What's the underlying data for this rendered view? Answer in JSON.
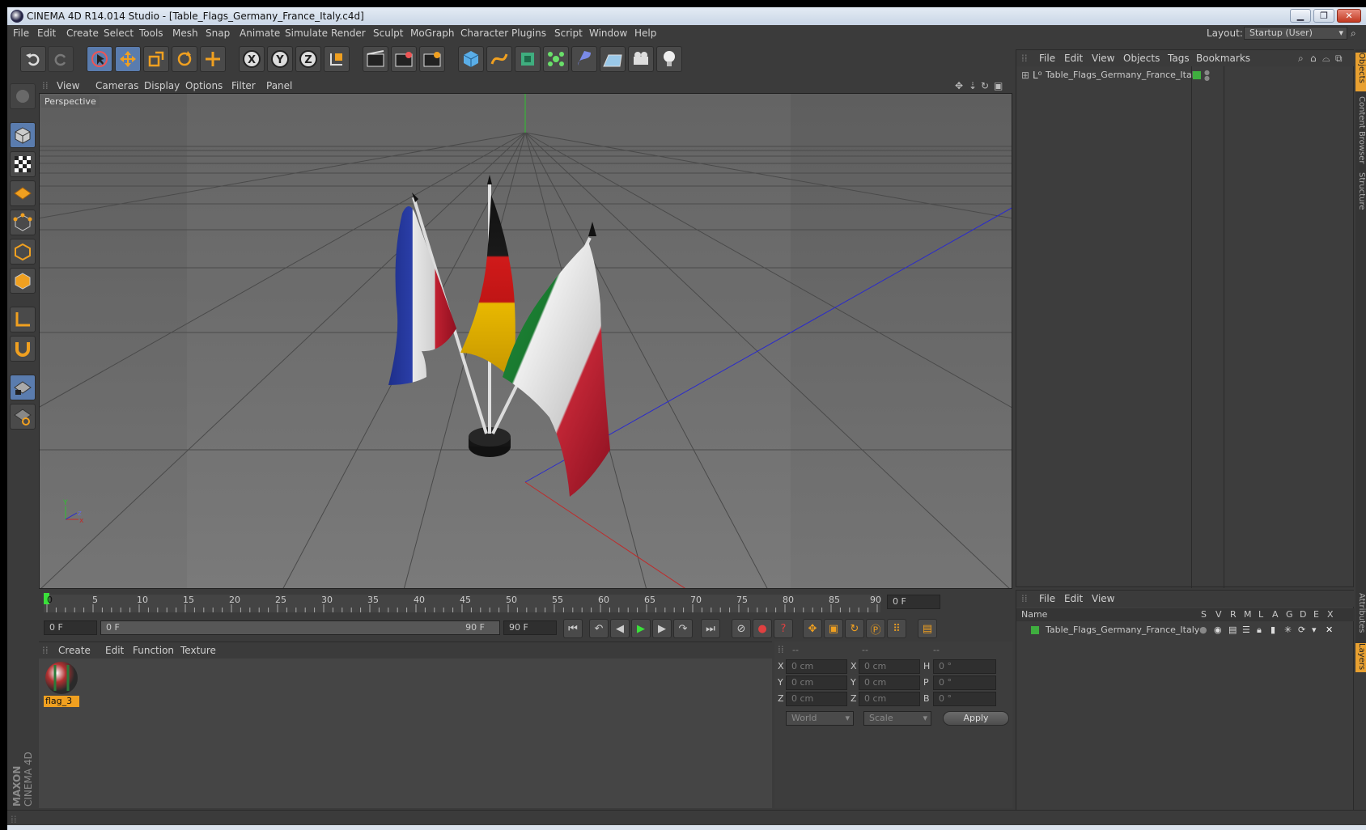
{
  "window": {
    "title": "CINEMA 4D R14.014 Studio - [Table_Flags_Germany_France_Italy.c4d]",
    "min_icon": "minimize-icon",
    "max_icon": "restore-icon",
    "close_icon": "close-icon"
  },
  "menubar": {
    "items": [
      "File",
      "Edit",
      "Create",
      "Select",
      "Tools",
      "Mesh",
      "Snap",
      "Animate",
      "Simulate",
      "Render",
      "Sculpt",
      "MoGraph",
      "Character",
      "Plugins",
      "Script",
      "Window",
      "Help"
    ],
    "layout_label": "Layout:",
    "layout_value": "Startup (User)"
  },
  "toolbar": {
    "icons": [
      "undo-icon",
      "redo-icon",
      "live-selection-icon",
      "move-icon",
      "scale-icon",
      "rotate-icon",
      "add-icon",
      "x-axis-icon",
      "y-axis-icon",
      "z-axis-icon",
      "coordinate-system-icon",
      "render-view-icon",
      "render-picture-viewer-icon",
      "edit-render-settings-icon",
      "cube-icon",
      "spline-icon",
      "nurbs-icon",
      "array-icon",
      "deformer-icon",
      "floor-icon",
      "camera-icon",
      "light-icon"
    ],
    "axis_labels": [
      "X",
      "Y",
      "Z"
    ]
  },
  "left_tools": [
    "make-editable-icon",
    "model-mode-icon",
    "texture-mode-icon",
    "workplane-icon",
    "points-mode-icon",
    "edges-mode-icon",
    "polygons-mode-icon",
    "axis-mode-icon",
    "magnet-icon",
    "snap-grid-icon",
    "snap-settings-icon"
  ],
  "viewport": {
    "menu": [
      "View",
      "Cameras",
      "Display",
      "Options",
      "Filter",
      "Panel"
    ],
    "label": "Perspective",
    "axis_gizmo": {
      "x": "x",
      "y": "Y",
      "z": "z"
    }
  },
  "timeline": {
    "ticks": [
      "0",
      "5",
      "10",
      "15",
      "20",
      "25",
      "30",
      "35",
      "40",
      "45",
      "50",
      "55",
      "60",
      "65",
      "70",
      "75",
      "80",
      "85",
      "90"
    ],
    "current_frame": "0 F"
  },
  "transport": {
    "start_field": "0 F",
    "range_start": "0 F",
    "range_end": "90 F",
    "end_field": "90 F"
  },
  "material_panel": {
    "menu": [
      "Create",
      "Edit",
      "Function",
      "Texture"
    ],
    "materials": [
      {
        "name": "flag_3"
      }
    ]
  },
  "coordinates": {
    "headers": [
      "--",
      "--",
      "--"
    ],
    "rows": [
      {
        "a_label": "X",
        "a_val": "0 cm",
        "b_label": "X",
        "b_val": "0 cm",
        "c_label": "H",
        "c_val": "0 °"
      },
      {
        "a_label": "Y",
        "a_val": "0 cm",
        "b_label": "Y",
        "b_val": "0 cm",
        "c_label": "P",
        "c_val": "0 °"
      },
      {
        "a_label": "Z",
        "a_val": "0 cm",
        "b_label": "Z",
        "b_val": "0 cm",
        "c_label": "B",
        "c_val": "0 °"
      }
    ],
    "world": "World",
    "scale": "Scale",
    "apply": "Apply"
  },
  "object_manager": {
    "menu": [
      "File",
      "Edit",
      "View",
      "Objects",
      "Tags",
      "Bookmarks"
    ],
    "objects": [
      {
        "name": "Table_Flags_Germany_France_Italy",
        "color": "#3fae3f"
      }
    ]
  },
  "layer_manager": {
    "menu": [
      "File",
      "Edit",
      "View"
    ],
    "name_header": "Name",
    "columns": [
      "S",
      "V",
      "R",
      "M",
      "L",
      "A",
      "G",
      "D",
      "E",
      "X"
    ],
    "layers": [
      {
        "name": "Table_Flags_Germany_France_Italy"
      }
    ]
  },
  "right_tabs": [
    "Objects",
    "Content Browser",
    "Structure",
    "Attributes",
    "Layers"
  ],
  "brand": {
    "maxon": "MAXON",
    "product": "CINEMA 4D"
  },
  "colors": {
    "accent": "#5a7cae",
    "panel": "#3b3b3b",
    "viewport": "#6a6a6a",
    "active_tab": "#e8a030"
  }
}
